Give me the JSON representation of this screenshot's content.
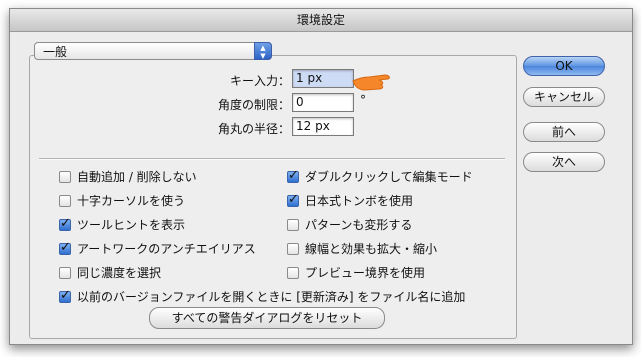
{
  "window": {
    "title": "環境設定"
  },
  "panel_popup": {
    "selected": "一般"
  },
  "fields": {
    "key_input": {
      "label": "キー入力：",
      "value": "1 px"
    },
    "angle_limit": {
      "label": "角度の制限：",
      "value": "0",
      "unit": "°"
    },
    "corner_radius": {
      "label": "角丸の半径：",
      "value": "12 px"
    }
  },
  "options": {
    "left": [
      {
        "label": "自動追加 / 削除しない",
        "checked": false
      },
      {
        "label": "十字カーソルを使う",
        "checked": false
      },
      {
        "label": "ツールヒントを表示",
        "checked": true
      },
      {
        "label": "アートワークのアンチエイリアス",
        "checked": true
      },
      {
        "label": "同じ濃度を選択",
        "checked": false
      }
    ],
    "right": [
      {
        "label": "ダブルクリックして編集モード",
        "checked": true
      },
      {
        "label": "日本式トンボを使用",
        "checked": true
      },
      {
        "label": "パターンも変形する",
        "checked": false
      },
      {
        "label": "線幅と効果も拡大・縮小",
        "checked": false
      },
      {
        "label": "プレビュー境界を使用",
        "checked": false
      }
    ],
    "full": {
      "label": "以前のバージョンファイルを開くときに [更新済み] をファイル名に追加",
      "checked": true
    }
  },
  "reset_warnings_button": "すべての警告ダイアログをリセット",
  "buttons": {
    "ok": "OK",
    "cancel": "キャンセル",
    "previous": "前へ",
    "next": "次へ"
  },
  "colors": {
    "default_button": "#5e95e3",
    "checkbox_on": "#2f6fd0"
  }
}
